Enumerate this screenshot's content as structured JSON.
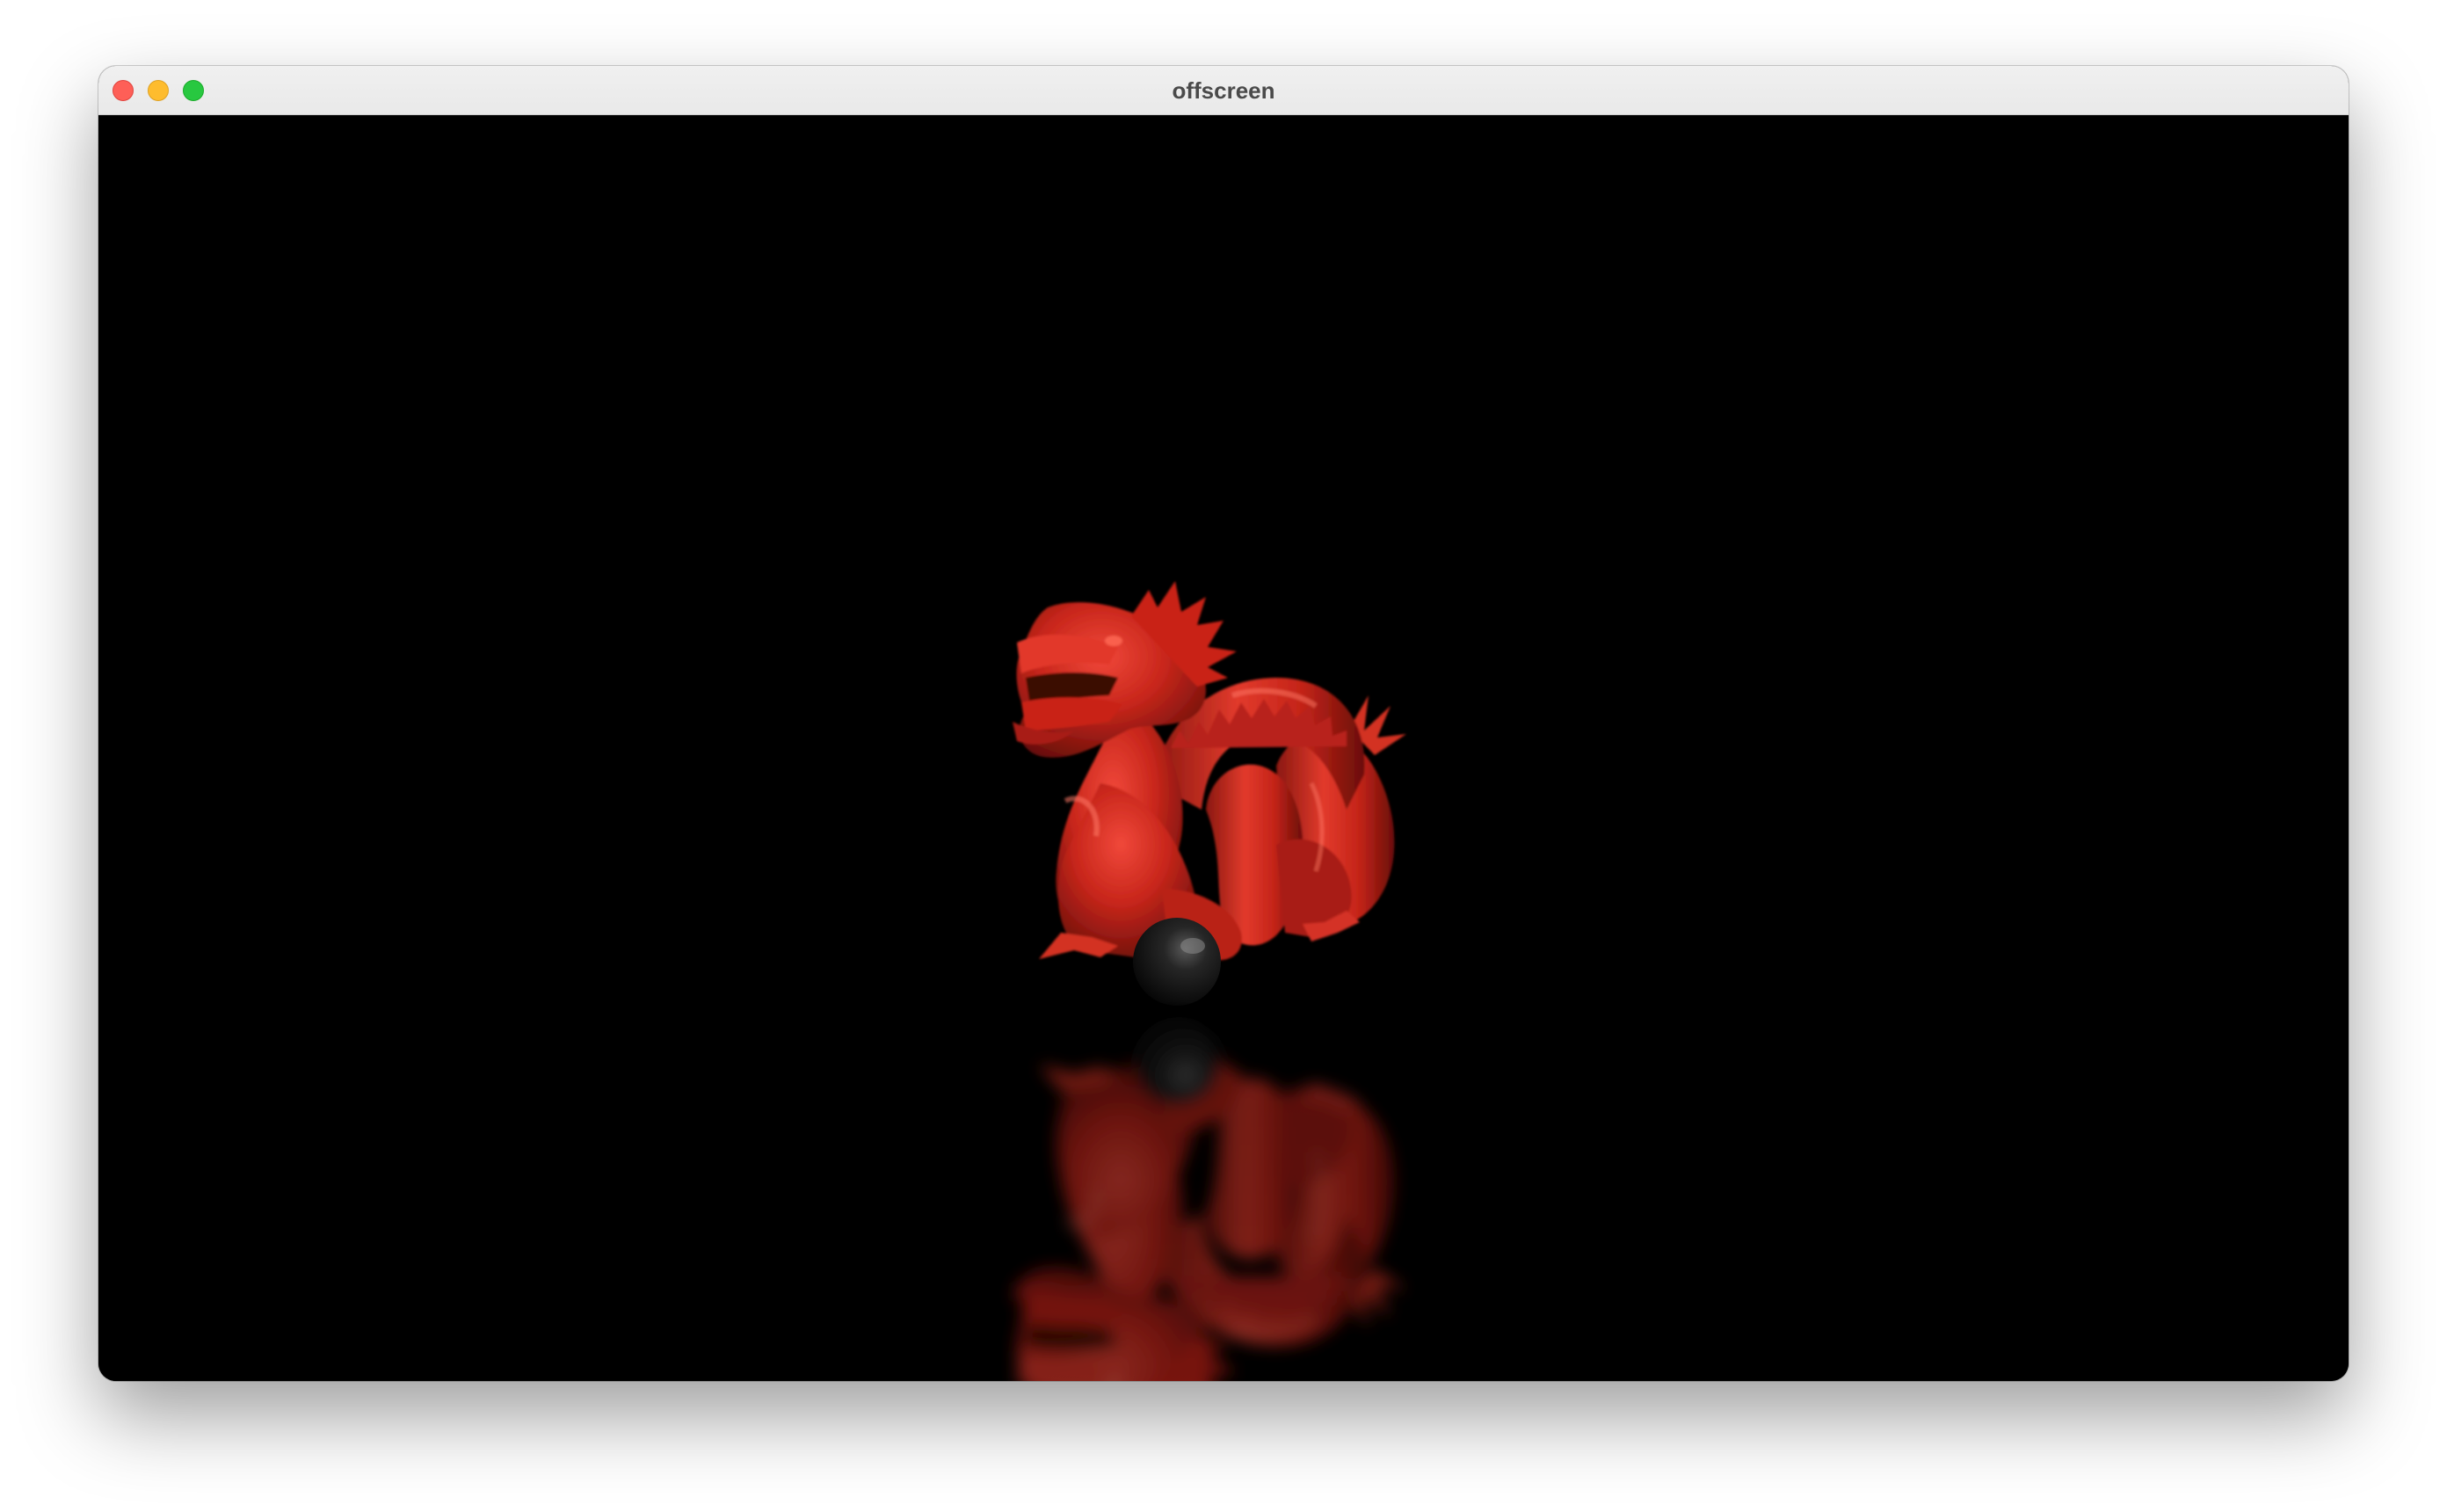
{
  "window": {
    "title": "offscreen",
    "controls": {
      "close_color": "#fe5f57",
      "minimize_color": "#febc2e",
      "zoom_color": "#28c840"
    }
  },
  "scene": {
    "background_color": "#000000",
    "objects": [
      {
        "name": "dragon",
        "color": "#c8261b"
      },
      {
        "name": "sphere",
        "color": "#1a1a1a"
      },
      {
        "name": "floor-reflection",
        "color": "#c8261b"
      }
    ]
  }
}
